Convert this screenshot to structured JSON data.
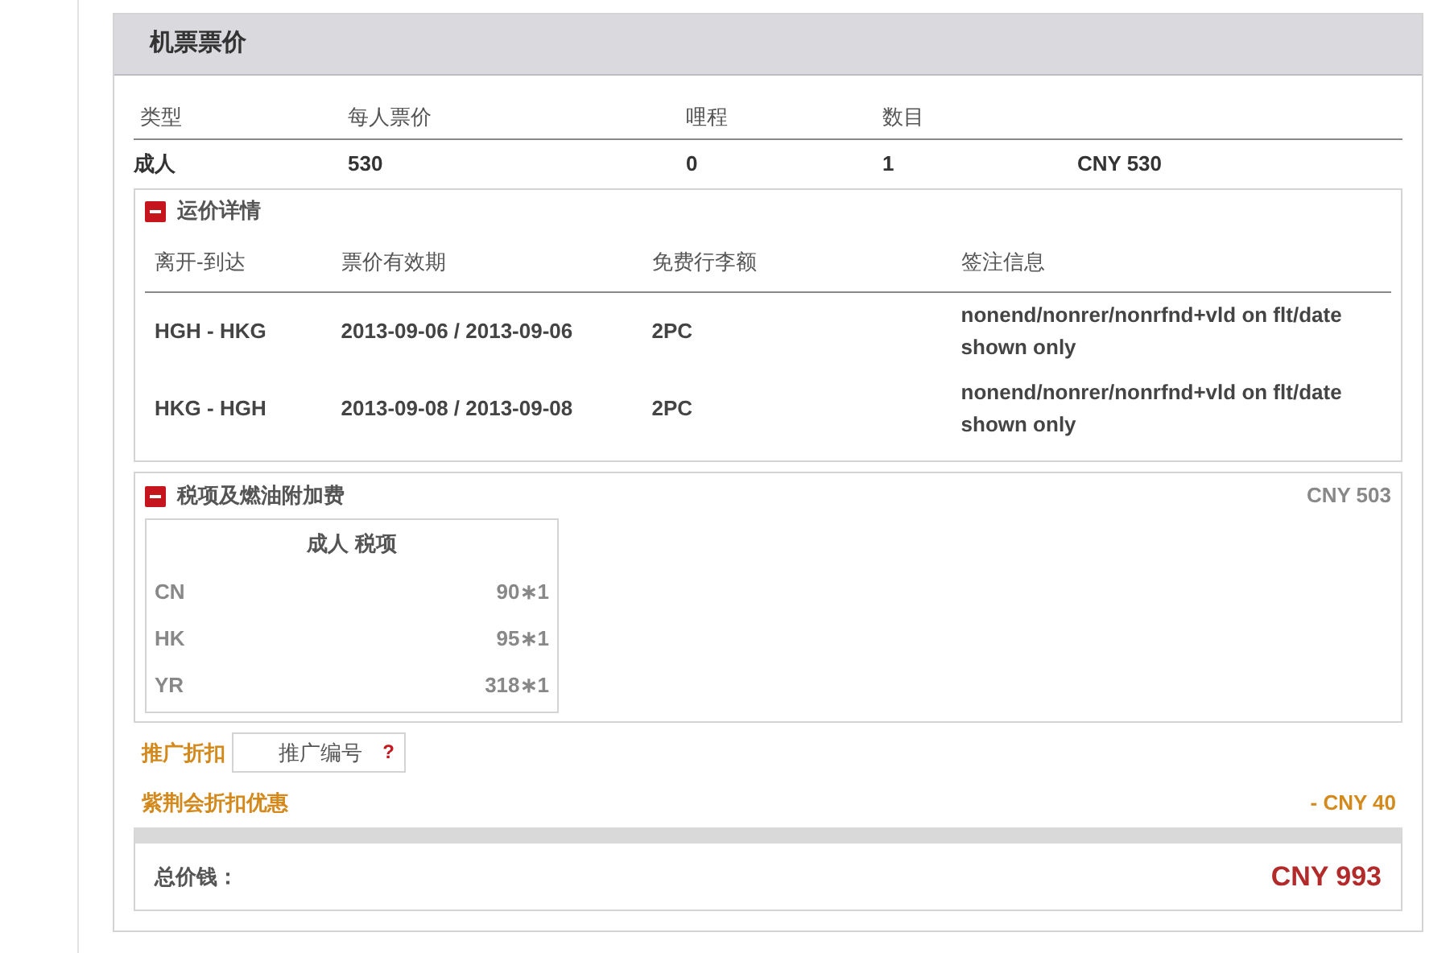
{
  "panel": {
    "title": "机票票价"
  },
  "price_table": {
    "columns": [
      "类型",
      "每人票价",
      "哩程",
      "数目"
    ],
    "rows": [
      {
        "cells": [
          "成人",
          "530",
          "0",
          "1",
          "CNY 530"
        ]
      }
    ]
  },
  "fare_details": {
    "title": "运价详情",
    "expanded": true,
    "columns": [
      "离开-到达",
      "票价有效期",
      "免费行李额",
      "签注信息"
    ],
    "rows": [
      {
        "cells": [
          "HGH - HKG",
          "2013-09-06 / 2013-09-06",
          "2PC",
          "nonend/nonrer/nonrfnd+vld on flt/date shown only"
        ]
      },
      {
        "cells": [
          "HKG - HGH",
          "2013-09-08 / 2013-09-08",
          "2PC",
          "nonend/nonrer/nonrfnd+vld on flt/date shown only"
        ]
      }
    ]
  },
  "taxes": {
    "title": "税项及燃油附加费",
    "expanded": true,
    "total": "CNY 503",
    "table_title": "成人 税项",
    "rows": [
      {
        "code": "CN",
        "amount": "90∗1"
      },
      {
        "code": "HK",
        "amount": "95∗1"
      },
      {
        "code": "YR",
        "amount": "318∗1"
      }
    ]
  },
  "promo": {
    "label": "推广折扣",
    "placeholder": "推广编号",
    "help": "?"
  },
  "discount": {
    "label": "紫荆会折扣优惠",
    "amount": "- CNY 40"
  },
  "total": {
    "label": "总价钱：",
    "amount": "CNY 993"
  }
}
